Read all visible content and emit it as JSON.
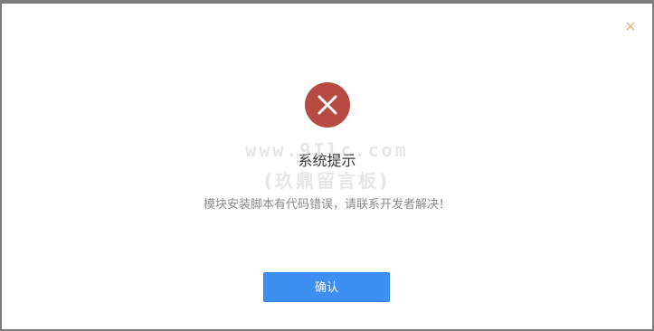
{
  "dialog": {
    "close_icon": "close-icon",
    "close_glyph": "✕",
    "status_icon": "error-x-icon",
    "title": "系统提示",
    "message": "模块安装脚本有代码错误，请联系开发者解决！",
    "confirm_label": "确认"
  },
  "watermark": {
    "line1": "www.9Ilc.com",
    "line2": "(玖鼎留言板)"
  },
  "colors": {
    "error": "#b84a44",
    "primary_button": "#3d8ff2",
    "close_icon": "#f2b68a"
  }
}
